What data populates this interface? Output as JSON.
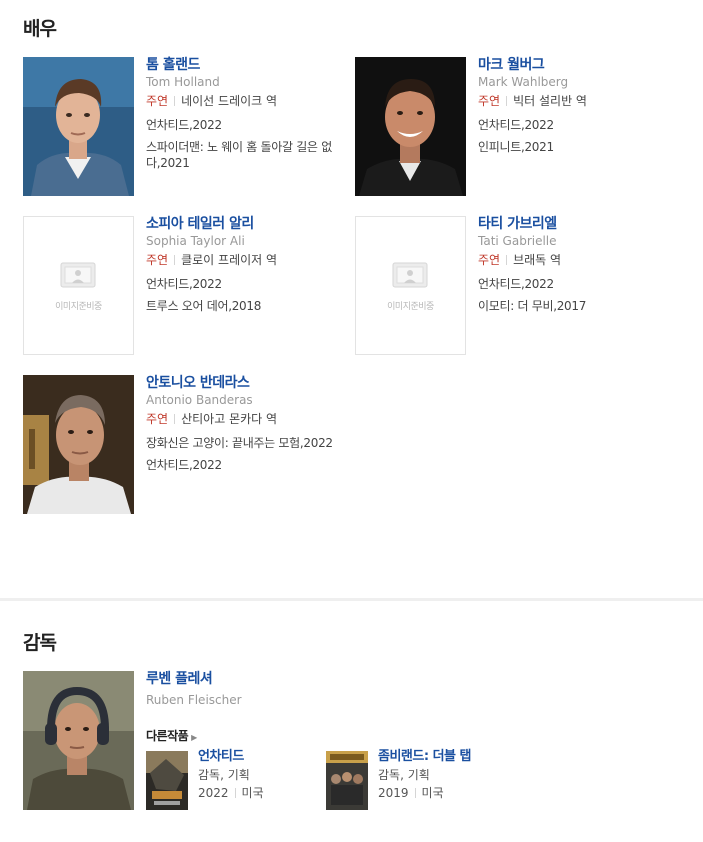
{
  "actors_section": {
    "title": "배우",
    "actors": [
      {
        "name": "톰 홀랜드",
        "eng": "Tom Holland",
        "lead": "주연",
        "role": "네이선 드레이크 역",
        "works": [
          "언차티드,2022",
          "스파이더맨: 노 웨이 홈 돌아갈 길은 없다,2021"
        ]
      },
      {
        "name": "마크 월버그",
        "eng": "Mark Wahlberg",
        "lead": "주연",
        "role": "빅터 설리반 역",
        "works": [
          "언차티드,2022",
          "인피니트,2021"
        ]
      },
      {
        "name": "소피아 테일러 알리",
        "eng": "Sophia Taylor Ali",
        "lead": "주연",
        "role": "클로이 프레이저 역",
        "works": [
          "언차티드,2022",
          "트루스 오어 데어,2018"
        ],
        "placeholder": "이미지준비중"
      },
      {
        "name": "타티 가브리엘",
        "eng": "Tati Gabrielle",
        "lead": "주연",
        "role": "브래독 역",
        "works": [
          "언차티드,2022",
          "이모티: 더 무비,2017"
        ],
        "placeholder": "이미지준비중"
      },
      {
        "name": "안토니오 반데라스",
        "eng": "Antonio Banderas",
        "lead": "주연",
        "role": "산티아고 몬카다 역",
        "works": [
          "장화신은 고양이: 끝내주는 모험,2022",
          "언차티드,2022"
        ]
      }
    ]
  },
  "director_section": {
    "title": "감독",
    "director": {
      "name": "루벤 플레셔",
      "eng": "Ruben Fleischer"
    },
    "other_works_label": "다른작품",
    "films": [
      {
        "title": "언차티드",
        "role": "감독, 기획",
        "year": "2022",
        "country": "미국"
      },
      {
        "title": "좀비랜드: 더블 탭",
        "role": "감독, 기획",
        "year": "2019",
        "country": "미국"
      }
    ]
  }
}
